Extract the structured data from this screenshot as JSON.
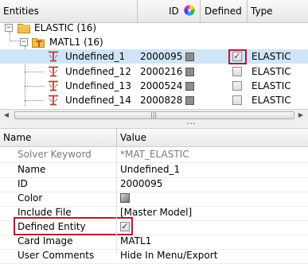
{
  "header": {
    "entities": "Entities",
    "id": "ID",
    "defined": "Defined",
    "type": "Type"
  },
  "tree": {
    "root": {
      "label": "ELASTIC (16)"
    },
    "group": {
      "label": "MATL1 (16)"
    },
    "items": [
      {
        "name": "Undefined_1",
        "id": "2000095",
        "type": "ELASTIC",
        "defined": true,
        "selected": true
      },
      {
        "name": "Undefined_12",
        "id": "2000216",
        "type": "ELASTIC",
        "defined": false,
        "selected": false
      },
      {
        "name": "Undefined_13",
        "id": "2000524",
        "type": "ELASTIC",
        "defined": false,
        "selected": false
      },
      {
        "name": "Undefined_14",
        "id": "2000828",
        "type": "ELASTIC",
        "defined": false,
        "selected": false
      }
    ]
  },
  "splitter_grip": "…",
  "properties": {
    "header": {
      "name": "Name",
      "value": "Value"
    },
    "rows": [
      {
        "name": "Solver Keyword",
        "value": "*MAT_ELASTIC",
        "readonly": true
      },
      {
        "name": "Name",
        "value": "Undefined_1"
      },
      {
        "name": "ID",
        "value": "2000095"
      },
      {
        "name": "Color",
        "value": ""
      },
      {
        "name": "Include File",
        "value": "[Master Model]"
      },
      {
        "name": "Defined Entity",
        "value": ""
      },
      {
        "name": "Card Image",
        "value": "MATL1"
      },
      {
        "name": "User Comments",
        "value": "Hide In Menu/Export"
      }
    ]
  },
  "colors": {
    "highlight_box": "#b01e2d",
    "selected_row": "#cfe5f7"
  }
}
